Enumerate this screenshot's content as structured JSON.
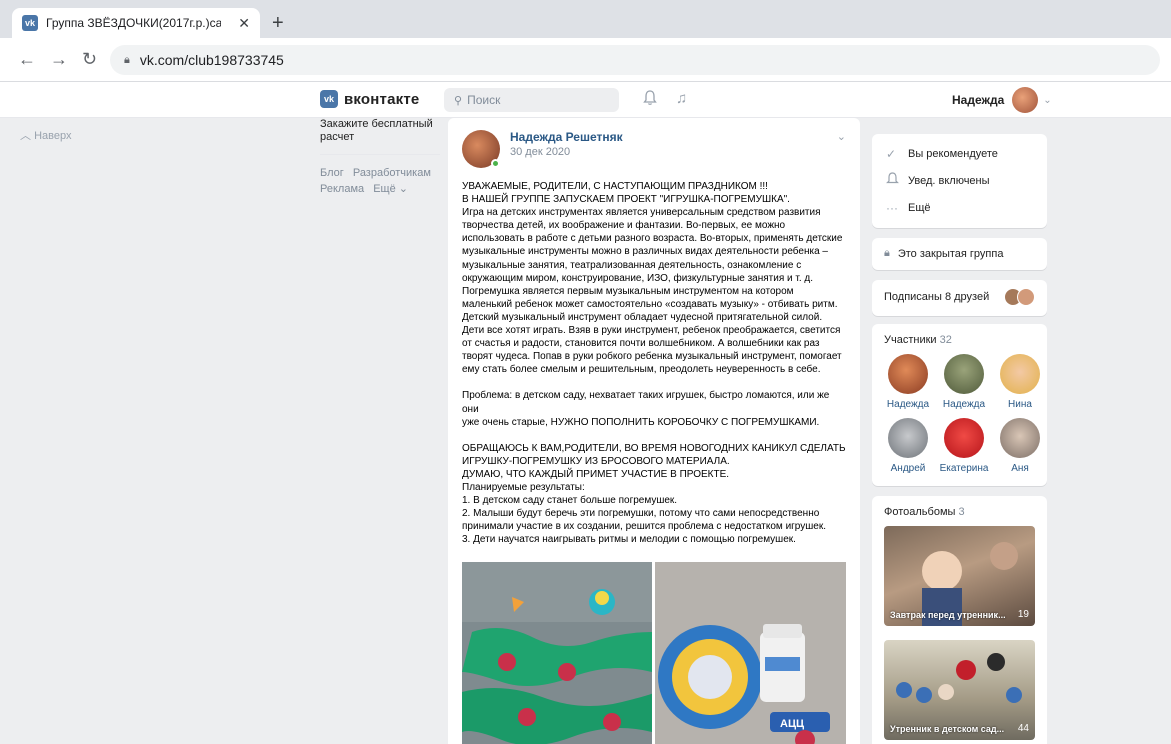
{
  "browser": {
    "tab_title": "Группа ЗВЁЗДОЧКИ(2017г.р.)са",
    "tab_close": "✕",
    "new_tab": "+",
    "url": "vk.com/club198733745"
  },
  "header": {
    "logo_text": "вконтакте",
    "search_placeholder": "Поиск",
    "user_name": "Надежда"
  },
  "left": {
    "up_label": "Наверх",
    "cut_text": "Закажите бесплатный расчет",
    "footer_links": [
      "Блог",
      "Разработчикам",
      "Реклама",
      "Ещё"
    ]
  },
  "post": {
    "author": "Надежда Решетняк",
    "date": "30 дек 2020",
    "lines": [
      "УВАЖАЕМЫЕ, РОДИТЕЛИ, С НАСТУПАЮЩИМ ПРАЗДНИКОМ !!!",
      "В НАШЕЙ ГРУППЕ ЗАПУСКАЕМ ПРОЕКТ \"ИГРУШКА-ПОГРЕМУШКА\".",
      "Игра на детских инструментах является универсальным средством развития",
      "творчества детей, их воображение и фантазии. Во-первых, ее можно",
      "использовать в работе с детьми разного возраста. Во-вторых, применять детские",
      "музыкальные инструменты можно в различных видах деятельности ребенка –",
      "музыкальные занятия, театрализованная деятельность, ознакомление с",
      "окружающим миром, конструирование, ИЗО, физкультурные занятия и т. д.",
      "Погремушка является первым музыкальным инструментом на котором",
      "маленький ребенок может самостоятельно «создавать музыку» - отбивать ритм.",
      "Детский музыкальный инструмент обладает чудесной притягательной силой.",
      "Дети все хотят играть. Взяв в руки инструмент, ребенок преображается, светится",
      "от счастья и радости, становится почти волшебником. А волшебники как раз",
      "творят чудеса. Попав в руки робкого ребенка музыкальный инструмент, помогает",
      "ему стать более смелым и решительным, преодолеть неуверенность в себе.",
      "",
      "Проблема: в детском саду, нехватает таких игрушек, быстро ломаются, или же они",
      "уже очень старые, НУЖНО ПОПОЛНИТЬ КОРОБОЧКУ С ПОГРЕМУШКАМИ.",
      "",
      "ОБРАЩАЮСЬ К ВАМ,РОДИТЕЛИ, ВО ВРЕМЯ НОВОГОДНИХ КАНИКУЛ СДЕЛАТЬ",
      "ИГРУШКУ-ПОГРЕМУШКУ ИЗ БРОСОВОГО МАТЕРИАЛА.",
      "ДУМАЮ, ЧТО КАЖДЫЙ ПРИМЕТ УЧАСТИЕ В ПРОЕКТЕ.",
      "Планируемые результаты:",
      "1. В детском саду станет больше погремушек.",
      "2. Малыши будут беречь эти погремушки, потому что сами непосредственно",
      "принимали участие в их создании, решится проблема с недостатком игрушек.",
      "3. Дети научатся наигрывать ритмы и мелодии с помощью погремушек."
    ],
    "photo2_label": "АЦЦ"
  },
  "right": {
    "actions": [
      {
        "icon": "check-icon",
        "glyph": "✓",
        "label": "Вы рекомендуете"
      },
      {
        "icon": "bell-icon",
        "glyph": "♫",
        "label": "Увед. включены"
      },
      {
        "icon": "more-icon",
        "glyph": "···",
        "label": "Ещё"
      }
    ],
    "closed_label": "Это закрытая группа",
    "friends_label": "Подписаны 8 друзей",
    "members_title": "Участники",
    "members_count": "32",
    "members": [
      "Надежда",
      "Надежда",
      "Нина",
      "Андрей",
      "Екатерина",
      "Аня"
    ],
    "albums_title": "Фотоальбомы",
    "albums_count": "3",
    "albums": [
      {
        "caption": "Завтрак перед утренник...",
        "count": "19"
      },
      {
        "caption": "Утренник в детском сад...",
        "count": "44"
      }
    ]
  },
  "colors": {
    "accent": "#4a76a8",
    "link": "#2a5885",
    "background": "#edeef0"
  }
}
